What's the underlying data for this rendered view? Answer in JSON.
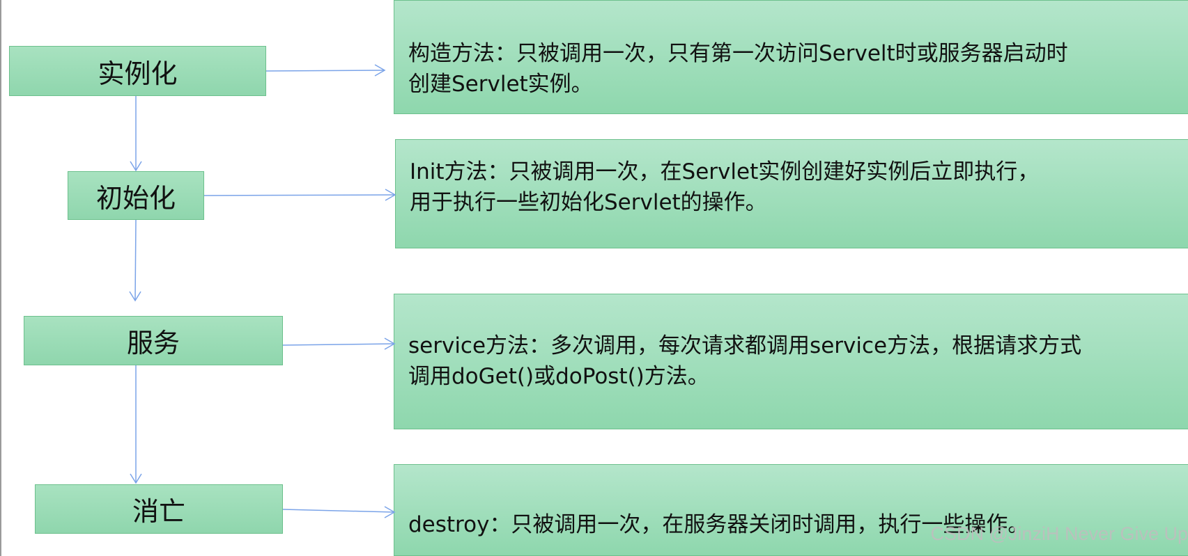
{
  "stages": [
    {
      "label": "实例化"
    },
    {
      "label": "初始化"
    },
    {
      "label": "服务"
    },
    {
      "label": "消亡"
    }
  ],
  "descriptions": [
    {
      "lines": [
        "构造方法：只被调用一次，只有第一次访问Servelt时或服务器启动时",
        "创建Servlet实例。"
      ]
    },
    {
      "lines": [
        "Init方法：只被调用一次，在Servlet实例创建好实例后立即执行，",
        "用于执行一些初始化Servlet的操作。"
      ]
    },
    {
      "lines": [
        "service方法：多次调用，每次请求都调用service方法，根据请求方式",
        "调用doGet()或doPost()方法。"
      ]
    },
    {
      "lines": [
        "destroy：只被调用一次，在服务器关闭时调用，执行一些操作。"
      ]
    }
  ],
  "watermark": "CSDN @JinziH Never Give Up",
  "colors": {
    "box_fill": "#9ad9b4",
    "box_border": "#6cc08c",
    "arrow": "#7aa3e8"
  }
}
